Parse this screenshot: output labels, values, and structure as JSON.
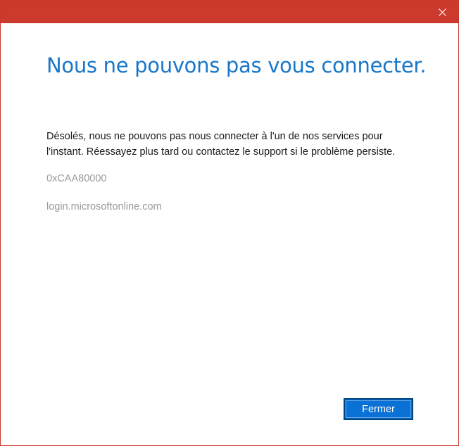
{
  "window": {
    "titlebar_color": "#cc3a2d",
    "close_icon": "close-icon"
  },
  "dialog": {
    "title": "Nous ne pouvons pas vous connecter.",
    "message": "Désolés, nous ne pouvons pas nous connecter à l'un de nos services pour l'instant. Réessayez plus tard ou contactez le support si le problème persiste.",
    "error_code": "0xCAA80000",
    "domain": "login.microsoftonline.com",
    "accent_color": "#1976c8"
  },
  "actions": {
    "close_label": "Fermer",
    "button_color": "#0a72d6"
  }
}
